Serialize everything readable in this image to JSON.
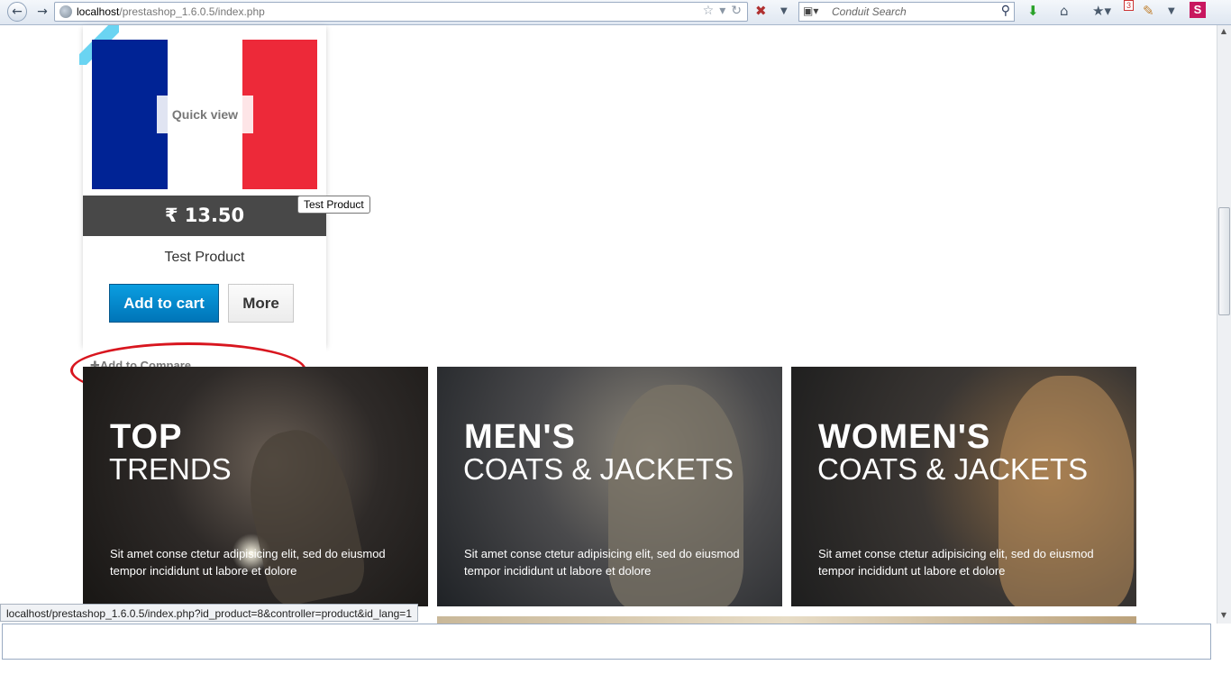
{
  "browser": {
    "url_host": "localhost",
    "url_path": "/prestashop_1.6.0.5/index.php",
    "search_placeholder": "Conduit Search",
    "notification_count": "3",
    "s_badge": "S",
    "status_url": "localhost/prestashop_1.6.0.5/index.php?id_product=8&controller=product&id_lang=1"
  },
  "product": {
    "name": "Test Product",
    "price": "₹ 13.50",
    "quick_view": "Quick view",
    "add_to_cart": "Add to cart",
    "more": "More",
    "add_to_compare": "Add to Compare",
    "tooltip": "Test Product"
  },
  "banners": [
    {
      "title": "TOP",
      "subtitle": "TRENDS",
      "description": "Sit amet conse ctetur adipisicing elit, sed do eiusmod tempor incididunt ut labore et dolore"
    },
    {
      "title": "MEN'S",
      "subtitle": "COATS & JACKETS",
      "description": "Sit amet conse ctetur adipisicing elit, sed do eiusmod tempor incididunt ut labore et dolore"
    },
    {
      "title": "WOMEN'S",
      "subtitle": "COATS & JACKETS",
      "description": "Sit amet conse ctetur adipisicing elit, sed do eiusmod tempor incididunt ut labore et dolore"
    }
  ],
  "colors": {
    "cart_button": "#0a8fd1",
    "price_bar": "#484848",
    "annotation": "#d8161f",
    "flag_blue": "#002395",
    "flag_red": "#ed2939"
  },
  "icons": [
    "back-arrow-icon",
    "forward-arrow-icon",
    "globe-icon",
    "star-icon",
    "reload-icon",
    "home-icon",
    "download-icon",
    "search-icon",
    "plus-icon"
  ]
}
